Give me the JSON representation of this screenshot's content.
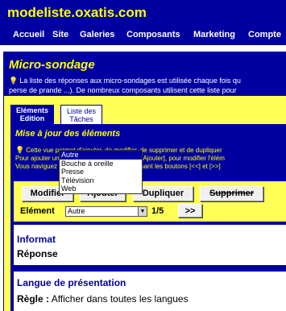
{
  "site": {
    "title": "modeliste.oxatis.com"
  },
  "nav": [
    "Accueil",
    "Site",
    "Galeries",
    "Composants",
    "Marketing",
    "Compte"
  ],
  "module": {
    "title": "Micro-sondage",
    "desc_line1": "La liste des réponses aux micro-sondages est utilisée chaque fois qu",
    "desc_line2": "perse de prande ...). De nombreux composants utilisent cette liste pour"
  },
  "tabs": {
    "active_line1": "Eléments",
    "active_line2": "Edition",
    "inactive_line1": "Liste des",
    "inactive_line2": "Tâches"
  },
  "panel": {
    "title": "Mise à jour des éléments",
    "desc_line1": "Cette vue permet d'ajouter, de modifier, de supprimer et de dupliquer",
    "desc_line2": "Pour ajouter un nouvel élément, cliquez sur [Ajouter], pour modifier l'élém",
    "desc_line3": "Vous naviguez d'un élément à l'autre en utilisant les boutons [<<] et [>>]"
  },
  "toolbar": {
    "modifier": "Modifier",
    "ajouter": "Ajouter",
    "dupliquer": "Dupliquer",
    "supprimer": "Supprimer",
    "element_label": "Elément",
    "selected": "Autre",
    "counter": "1/5",
    "next": ">>"
  },
  "dropdown": [
    "Autre",
    "Bouche à oreille",
    "Presse",
    "Télévision",
    "Web"
  ],
  "card1": {
    "title": "Informat",
    "label": "Réponse"
  },
  "card2": {
    "title": "Langue de présentation",
    "label": "Règle :",
    "value": " Afficher dans toutes les langues"
  }
}
